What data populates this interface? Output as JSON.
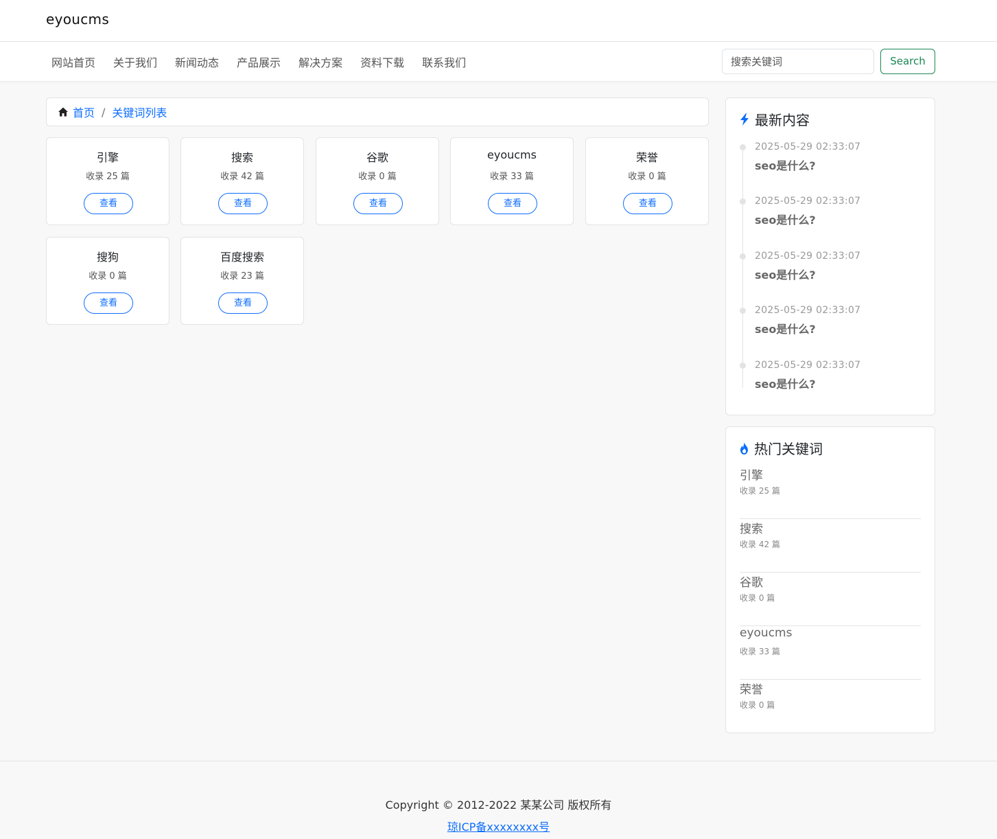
{
  "header": {
    "brand": "eyoucms"
  },
  "nav": {
    "items": [
      "网站首页",
      "关于我们",
      "新闻动态",
      "产品展示",
      "解决方案",
      "资料下载",
      "联系我们"
    ],
    "search_placeholder": "搜索关键词",
    "search_button": "Search"
  },
  "breadcrumb": {
    "home": "首页",
    "separator": "/",
    "current": "关键词列表"
  },
  "keywords": [
    {
      "name": "引擎",
      "count": "收录 25 篇",
      "button": "查看"
    },
    {
      "name": "搜索",
      "count": "收录 42 篇",
      "button": "查看"
    },
    {
      "name": "谷歌",
      "count": "收录 0 篇",
      "button": "查看"
    },
    {
      "name": "eyoucms",
      "count": "收录 33 篇",
      "button": "查看"
    },
    {
      "name": "荣誉",
      "count": "收录 0 篇",
      "button": "查看"
    },
    {
      "name": "搜狗",
      "count": "收录 0 篇",
      "button": "查看"
    },
    {
      "name": "百度搜索",
      "count": "收录 23 篇",
      "button": "查看"
    }
  ],
  "latest": {
    "title": "最新内容",
    "icon": "lightning-icon",
    "items": [
      {
        "date": "2025-05-29 02:33:07",
        "title": "seo是什么?"
      },
      {
        "date": "2025-05-29 02:33:07",
        "title": "seo是什么?"
      },
      {
        "date": "2025-05-29 02:33:07",
        "title": "seo是什么?"
      },
      {
        "date": "2025-05-29 02:33:07",
        "title": "seo是什么?"
      },
      {
        "date": "2025-05-29 02:33:07",
        "title": "seo是什么?"
      }
    ]
  },
  "hot": {
    "title": "热门关键词",
    "icon": "fire-icon",
    "items": [
      {
        "name": "引擎",
        "count": "收录 25 篇"
      },
      {
        "name": "搜索",
        "count": "收录 42 篇"
      },
      {
        "name": "谷歌",
        "count": "收录 0 篇"
      },
      {
        "name": "eyoucms",
        "count": "收录 33 篇"
      },
      {
        "name": "荣誉",
        "count": "收录 0 篇"
      }
    ]
  },
  "footer": {
    "copyright": "Copyright © 2012-2022 某某公司 版权所有",
    "icp": "琼ICP备xxxxxxxx号"
  },
  "colors": {
    "primary": "#0d6efd",
    "success": "#198754",
    "background": "#f8f8f8"
  }
}
